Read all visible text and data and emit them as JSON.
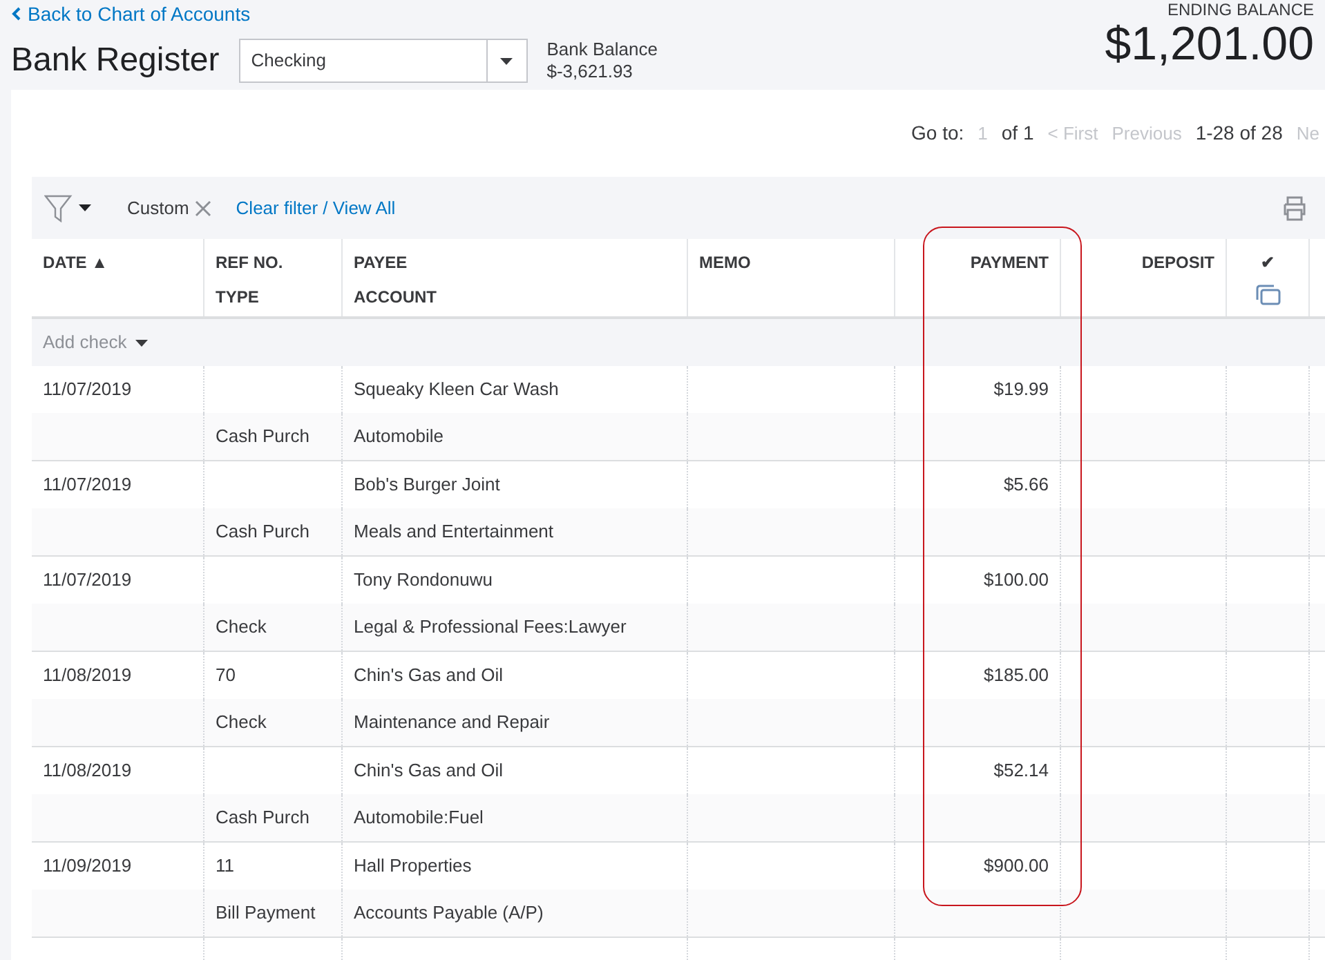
{
  "back_link": "Back to Chart of Accounts",
  "title": "Bank Register",
  "account_select": {
    "value": "Checking"
  },
  "bank_balance": {
    "label": "Bank Balance",
    "value": "$-3,621.93"
  },
  "ending_balance": {
    "label": "ENDING BALANCE",
    "value": "$1,201.00"
  },
  "pagination": {
    "goto_label": "Go to:",
    "page": "1",
    "of": "of 1",
    "first": "< First",
    "previous": "Previous",
    "range": "1-28 of 28",
    "next": "Ne"
  },
  "filter": {
    "chip": "Custom",
    "clear": "Clear filter / View All"
  },
  "columns": [
    {
      "top": "DATE ▲"
    },
    {
      "top": "REF NO.",
      "bottom": "TYPE"
    },
    {
      "top": "PAYEE",
      "bottom": "ACCOUNT"
    },
    {
      "top": "MEMO"
    },
    {
      "top": "PAYMENT"
    },
    {
      "top": "DEPOSIT"
    },
    {
      "top": "✔"
    }
  ],
  "add_check": "Add check",
  "rows": [
    {
      "date": "11/07/2019",
      "ref": "",
      "type": "Cash Purch",
      "payee": "Squeaky Kleen Car Wash",
      "account": "Automobile",
      "payment": "$19.99"
    },
    {
      "date": "11/07/2019",
      "ref": "",
      "type": "Cash Purch",
      "payee": "Bob's Burger Joint",
      "account": "Meals and Entertainment",
      "payment": "$5.66"
    },
    {
      "date": "11/07/2019",
      "ref": "",
      "type": "Check",
      "payee": "Tony Rondonuwu",
      "account": "Legal & Professional Fees:Lawyer",
      "payment": "$100.00"
    },
    {
      "date": "11/08/2019",
      "ref": "70",
      "type": "Check",
      "payee": "Chin's Gas and Oil",
      "account": "Maintenance and Repair",
      "payment": "$185.00"
    },
    {
      "date": "11/08/2019",
      "ref": "",
      "type": "Cash Purch",
      "payee": "Chin's Gas and Oil",
      "account": "Automobile:Fuel",
      "payment": "$52.14"
    },
    {
      "date": "11/09/2019",
      "ref": "11",
      "type": "Bill Payment",
      "payee": "Hall Properties",
      "account": "Accounts Payable (A/P)",
      "payment": "$900.00"
    }
  ]
}
